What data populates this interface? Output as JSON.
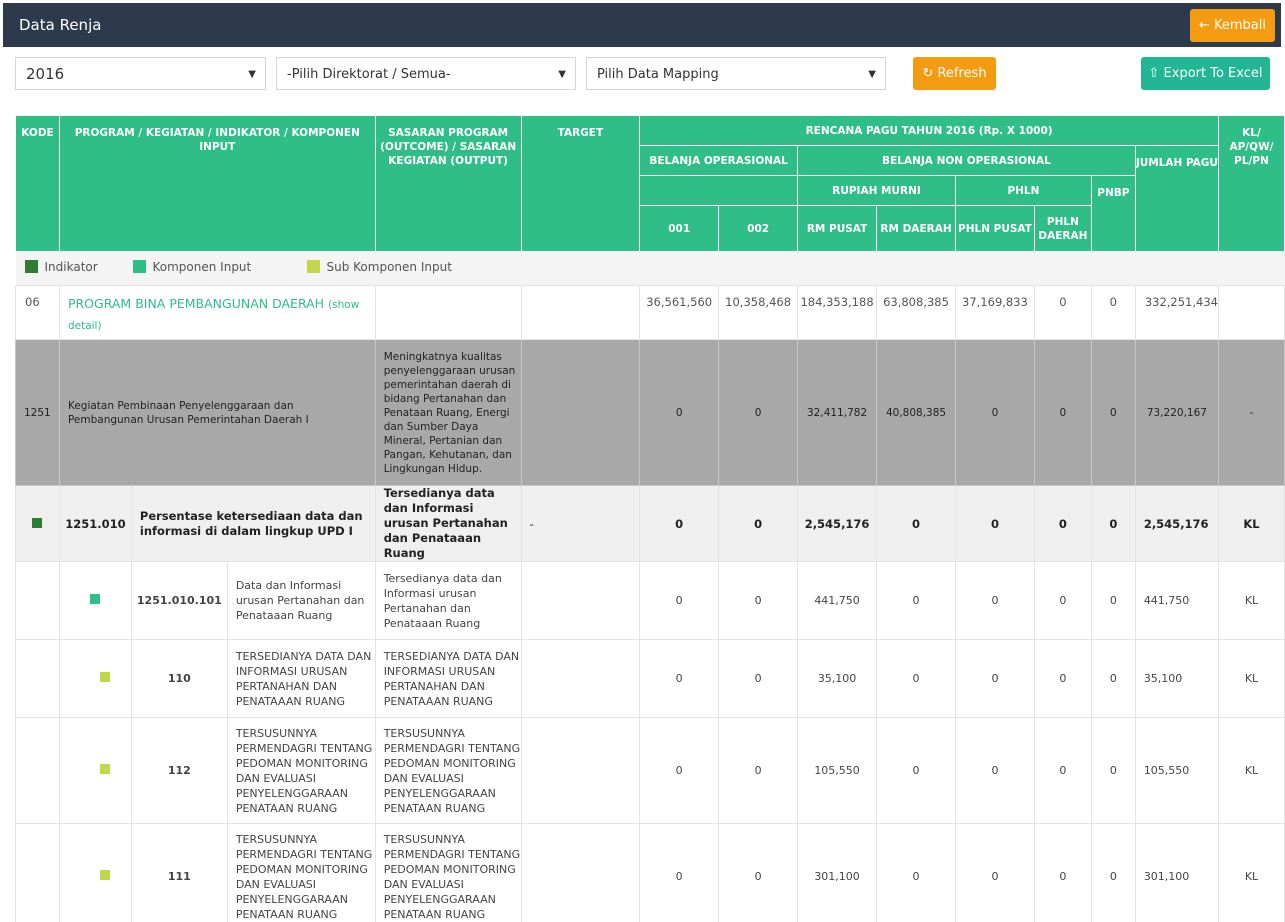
{
  "header": {
    "title": "Data Renja",
    "back_label": "← Kembali"
  },
  "filters": {
    "year": "2016",
    "direktorat": "-Pilih Direktorat / Semua-",
    "mapping": "Pilih Data Mapping",
    "refresh_label": "↻ Refresh",
    "export_label": "⇧ Export To Excel"
  },
  "table": {
    "headers": {
      "kode": "KODE",
      "program": "PROGRAM / KEGIATAN / INDIKATOR / KOMPONEN INPUT",
      "sasaran": "SASARAN PROGRAM (OUTCOME) / SASARAN KEGIATAN (OUTPUT)",
      "target": "TARGET",
      "rencana": "RENCANA PAGU TAHUN 2016 (Rp. X 1000)",
      "kl": "KL/ AP/QW/ PL/PN",
      "belanja_op": "BELANJA OPERASIONAL",
      "belanja_nonop": "BELANJA NON OPERASIONAL",
      "jumlah": "JUMLAH PAGU",
      "rupiah_murni": "RUPIAH MURNI",
      "phln": "PHLN",
      "pnbp": "PNBP",
      "c001": "001",
      "c002": "002",
      "rm_pusat": "RM PUSAT",
      "rm_daerah": "RM DAERAH",
      "phln_pusat": "PHLN PUSAT",
      "phln_daerah": "PHLN DAERAH"
    },
    "legend": {
      "indikator": "Indikator",
      "komponen": "Komponen Input",
      "sub": "Sub Komponen Input"
    },
    "program_row": {
      "kode": "06",
      "name": "PROGRAM BINA PEMBANGUNAN DAERAH",
      "detail": "(show detail)",
      "v001": "36,561,560",
      "v002": "10,358,468",
      "rm_pusat": "184,353,188",
      "rm_daerah": "63,808,385",
      "phln_pusat": "37,169,833",
      "phln_daerah": "0",
      "pnbp": "0",
      "jumlah": "332,251,434"
    },
    "kegiatan_row": {
      "kode": "1251",
      "name": "Kegiatan Pembinaan Penyelenggaraan dan Pembangunan Urusan Pemerintahan Daerah I",
      "sasaran": "Meningkatnya kualitas penyelenggaraan urusan pemerintahan daerah di bidang Pertanahan dan Penataan Ruang, Energi dan Sumber Daya Mineral, Pertanian dan Pangan, Kehutanan, dan Lingkungan Hidup.",
      "v001": "0",
      "v002": "0",
      "rm_pusat": "32,411,782",
      "rm_daerah": "40,808,385",
      "phln_pusat": "0",
      "phln_daerah": "0",
      "pnbp": "0",
      "jumlah": "73,220,167",
      "kl": "-"
    },
    "indikator_row": {
      "kode": "1251.010",
      "name": "Persentase ketersediaan data dan informasi di dalam lingkup UPD I",
      "sasaran": "Tersedianya data dan Informasi urusan Pertanahan dan Penataaan Ruang",
      "target": "-",
      "v001": "0",
      "v002": "0",
      "rm_pusat": "2,545,176",
      "rm_daerah": "0",
      "phln_pusat": "0",
      "phln_daerah": "0",
      "pnbp": "0",
      "jumlah": "2,545,176",
      "kl": "KL"
    },
    "komponen_row": {
      "kode": "1251.010.101",
      "name": "Data dan Informasi urusan Pertanahan dan Penataaan Ruang",
      "sasaran": "Tersedianya data dan Informasi urusan Pertanahan dan Penataaan Ruang",
      "v001": "0",
      "v002": "0",
      "rm_pusat": "441,750",
      "rm_daerah": "0",
      "phln_pusat": "0",
      "phln_daerah": "0",
      "pnbp": "0",
      "jumlah": "441,750",
      "kl": "KL"
    },
    "sub_rows": [
      {
        "kode": "110",
        "name": "TERSEDIANYA DATA DAN INFORMASI URUSAN PERTANAHAN DAN PENATAAAN RUANG",
        "sasaran": "TERSEDIANYA DATA DAN INFORMASI URUSAN PERTANAHAN DAN PENATAAAN RUANG",
        "v001": "0",
        "v002": "0",
        "rm_pusat": "35,100",
        "rm_daerah": "0",
        "phln_pusat": "0",
        "phln_daerah": "0",
        "pnbp": "0",
        "jumlah": "35,100",
        "kl": "KL"
      },
      {
        "kode": "112",
        "name": "TERSUSUNNYA PERMENDAGRI TENTANG PEDOMAN MONITORING DAN EVALUASI PENYELENGGARAAN PENATAAN RUANG",
        "sasaran": "TERSUSUNNYA PERMENDAGRI TENTANG PEDOMAN MONITORING DAN EVALUASI PENYELENGGARAAN PENATAAN RUANG",
        "v001": "0",
        "v002": "0",
        "rm_pusat": "105,550",
        "rm_daerah": "0",
        "phln_pusat": "0",
        "phln_daerah": "0",
        "pnbp": "0",
        "jumlah": "105,550",
        "kl": "KL"
      },
      {
        "kode": "111",
        "name": "TERSUSUNNYA PERMENDAGRI TENTANG PEDOMAN MONITORING DAN EVALUASI PENYELENGGARAAN PENATAAN RUANG",
        "sasaran": "TERSUSUNNYA PERMENDAGRI TENTANG PEDOMAN MONITORING DAN EVALUASI PENYELENGGARAAN PENATAAN RUANG",
        "v001": "0",
        "v002": "0",
        "rm_pusat": "301,100",
        "rm_daerah": "0",
        "phln_pusat": "0",
        "phln_daerah": "0",
        "pnbp": "0",
        "jumlah": "301,100",
        "kl": "KL"
      }
    ]
  }
}
